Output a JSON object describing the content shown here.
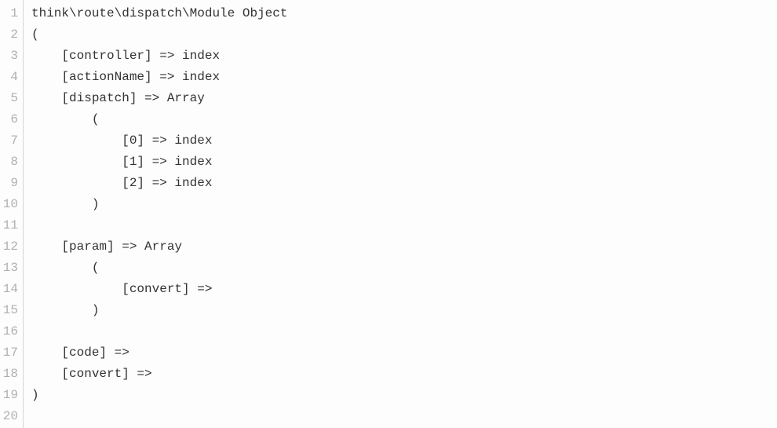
{
  "lines": [
    "think\\route\\dispatch\\Module Object",
    "(",
    "    [controller] => index",
    "    [actionName] => index",
    "    [dispatch] => Array",
    "        (",
    "            [0] => index",
    "            [1] => index",
    "            [2] => index",
    "        )",
    "",
    "    [param] => Array",
    "        (",
    "            [convert] => ",
    "        )",
    "",
    "    [code] => ",
    "    [convert] => ",
    ")",
    ""
  ]
}
